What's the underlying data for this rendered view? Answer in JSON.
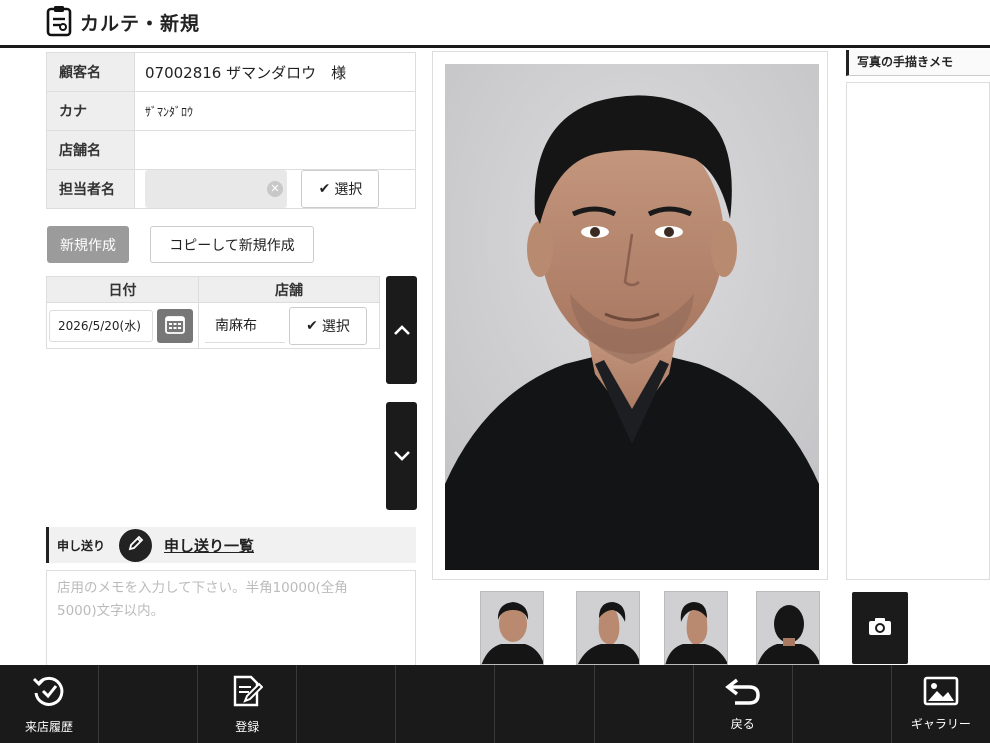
{
  "header": {
    "title": "カルテ・新規"
  },
  "customer": {
    "name_label": "顧客名",
    "name_value": "07002816 ザマンダロウ　様",
    "kana_label": "カナ",
    "kana_value": "ｻﾞﾏﾝﾀﾞﾛｳ",
    "shop_label": "店舗名",
    "shop_value": "",
    "staff_label": "担当者名",
    "staff_value": "",
    "select_label": "選択"
  },
  "actions": {
    "new_label": "新規作成",
    "copy_label": "コピーして新規作成"
  },
  "visit": {
    "date_header": "日付",
    "store_header": "店舗",
    "date_value": "2026/5/20(水)",
    "store_value": "南麻布",
    "select_label": "選択"
  },
  "memo": {
    "label": "申し送り",
    "list_link": "申し送り一覧",
    "placeholder_line1": "店用のメモを入力して下さい。半角10000(全角",
    "placeholder_line2": "5000)文字以内。"
  },
  "drawing_memo": {
    "title": "写真の手描きメモ"
  },
  "footer": {
    "history": "来店履歴",
    "register": "登録",
    "back": "戻る",
    "gallery": "ギャラリー"
  },
  "icons": [
    "clipboard-icon",
    "clear-icon",
    "check-icon",
    "calendar-icon",
    "chevron-up-icon",
    "chevron-down-icon",
    "pen-icon",
    "camera-icon",
    "history-icon",
    "register-icon",
    "back-icon",
    "gallery-icon"
  ]
}
